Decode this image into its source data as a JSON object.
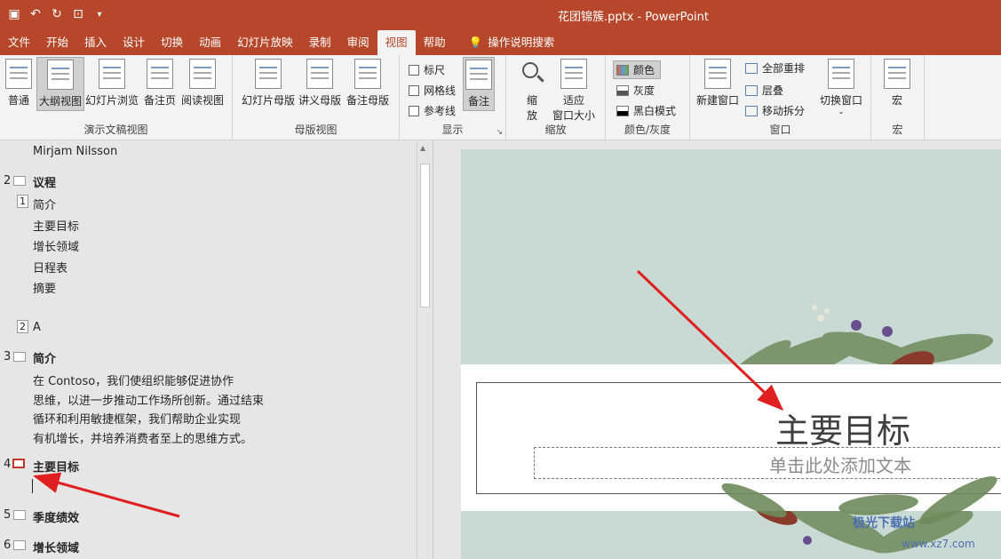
{
  "app": {
    "doc_title": "花团锦簇.pptx  -  PowerPoint",
    "qat_icons": [
      "save-icon",
      "undo-icon",
      "redo-icon",
      "present-icon",
      "customize-icon"
    ]
  },
  "tabs": [
    "文件",
    "开始",
    "插入",
    "设计",
    "切换",
    "动画",
    "幻灯片放映",
    "录制",
    "审阅",
    "视图",
    "帮助"
  ],
  "active_tab": "视图",
  "search_label": "操作说明搜索",
  "ribbon": {
    "presentation_views": {
      "label": "演示文稿视图",
      "buttons": [
        "普通",
        "大纲视图",
        "幻灯片浏览",
        "备注页",
        "阅读视图"
      ]
    },
    "master_views": {
      "label": "母版视图",
      "buttons": [
        "幻灯片母版",
        "讲义母版",
        "备注母版"
      ]
    },
    "show": {
      "label": "显示",
      "checkboxes": [
        "标尺",
        "网格线",
        "参考线"
      ],
      "notes": "备注"
    },
    "zoom": {
      "label": "缩放",
      "zoom_btn": "缩\n放",
      "zoom_line1": "缩",
      "zoom_line2": "放",
      "fit_line1": "适应",
      "fit_line2": "窗口大小"
    },
    "color": {
      "label": "颜色/灰度",
      "items": [
        "颜色",
        "灰度",
        "黑白模式"
      ]
    },
    "window": {
      "label": "窗口",
      "new_window": "新建窗口",
      "items": [
        "全部重排",
        "层叠",
        "移动拆分"
      ],
      "switch": "切换窗口"
    },
    "macro": {
      "label": "宏",
      "button": "宏"
    }
  },
  "outline": {
    "author": "Mirjam Nilsson",
    "slide2_num": "2",
    "slide2_title": "议程",
    "level1_badge": "1",
    "slide2_items": [
      "简介",
      "主要目标",
      "增长领域",
      "日程表",
      "摘要"
    ],
    "level2_badge": "2",
    "a_text": "A",
    "slide3_num": "3",
    "slide3_title": "简介",
    "slide3_body": [
      "在 Contoso，我们使组织能够促进协作",
      "思维，以进一步推动工作场所创新。通过结束",
      "循环和利用敏捷框架，我们帮助企业实现",
      "有机增长，并培养消费者至上的思维方式。"
    ],
    "slide4_num": "4",
    "slide4_title": "主要目标",
    "slide5_num": "5",
    "slide5_title": "季度绩效",
    "slide6_num": "6",
    "slide6_title": "增长领域"
  },
  "slide": {
    "title": "主要目标",
    "subtitle_placeholder": "单击此处添加文本"
  },
  "watermark": {
    "line1": "极光下载站",
    "line2": "www.xz7.com"
  }
}
